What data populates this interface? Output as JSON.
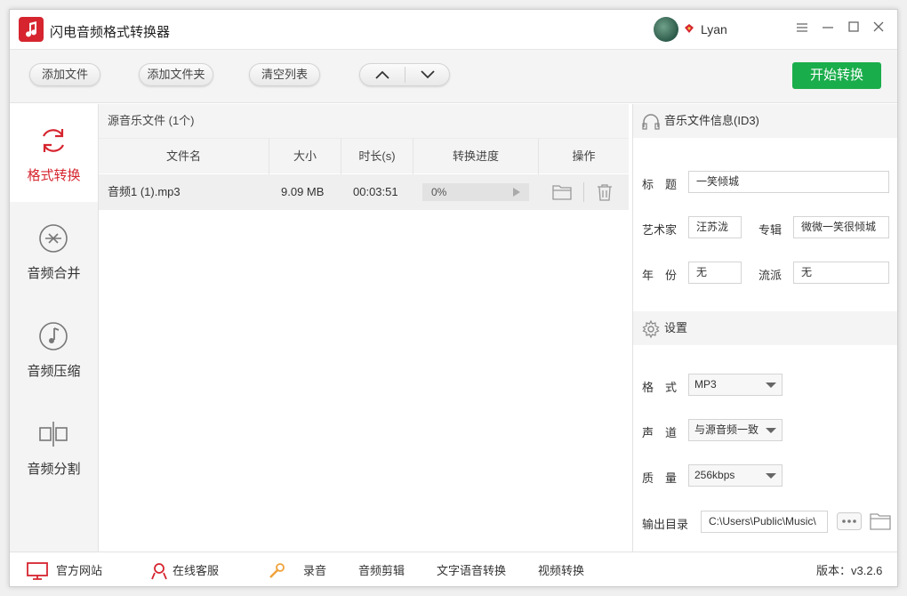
{
  "window": {
    "title": "闪电音频格式转换器",
    "user": "Lyan"
  },
  "toolbar": {
    "add_file": "添加文件",
    "add_folder": "添加文件夹",
    "clear_list": "清空列表",
    "start": "开始转换"
  },
  "sidebar": {
    "items": [
      {
        "label": "格式转换",
        "icon": "refresh-icon",
        "active": true
      },
      {
        "label": "音频合并",
        "icon": "merge-icon",
        "active": false
      },
      {
        "label": "音频压缩",
        "icon": "music-note-icon",
        "active": false
      },
      {
        "label": "音频分割",
        "icon": "split-icon",
        "active": false
      }
    ]
  },
  "filelist": {
    "header": "源音乐文件 (1个)",
    "columns": [
      "文件名",
      "大小",
      "时长(s)",
      "转换进度",
      "操作"
    ],
    "rows": [
      {
        "name": "音频1 (1).mp3",
        "size": "9.09 MB",
        "duration": "00:03:51",
        "progress": "0%",
        "progress_value": 0
      }
    ]
  },
  "info": {
    "section_title": "音乐文件信息(ID3)",
    "title_label": "标　题",
    "title_value": "一笑倾城",
    "artist_label": "艺术家",
    "artist_value": "汪苏泷",
    "album_label": "专辑",
    "album_value": "微微一笑很倾城",
    "year_label": "年　份",
    "year_value": "无",
    "genre_label": "流派",
    "genre_value": "无"
  },
  "settings": {
    "section_title": "设置",
    "format_label": "格　式",
    "format_value": "MP3",
    "channel_label": "声　道",
    "channel_value": "与源音频一致",
    "quality_label": "质　量",
    "quality_value": "256kbps",
    "output_label": "输出目录",
    "output_value": "C:\\Users\\Public\\Music\\"
  },
  "bottombar": {
    "website": "官方网站",
    "service": "在线客服",
    "record": "录音",
    "audio_edit": "音频剪辑",
    "tts": "文字语音转换",
    "video": "视频转换",
    "version": "版本：v3.2.6"
  },
  "colors": {
    "brand_red": "#d6252f",
    "start_green": "#1aad4b"
  }
}
